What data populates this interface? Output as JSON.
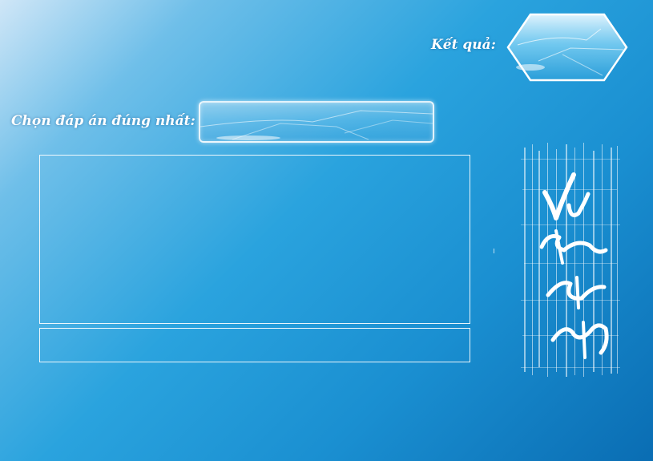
{
  "result": {
    "label": "Kết quả:",
    "value": ""
  },
  "answer": {
    "label": "Chọn đáp án đúng nhất:",
    "value": ""
  },
  "question": {
    "text": ""
  },
  "option": {
    "text": ""
  },
  "decoration": {
    "calligraphy_text": "Vui học đúng nhất"
  },
  "colors": {
    "background_top": "#cfe6f7",
    "background_mid": "#2aa3de",
    "background_bottom": "#0a6db3",
    "text": "#ffffff"
  }
}
